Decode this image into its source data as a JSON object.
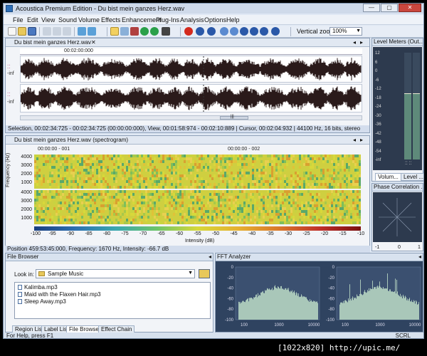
{
  "app": {
    "title": "Acoustica Premium Edition - Du bist mein ganzes Herz.wav"
  },
  "window_controls": {
    "minimize": "—",
    "maximize": "▢",
    "close": "✕"
  },
  "menu": [
    "File",
    "Edit",
    "View",
    "Sound",
    "Volume",
    "Effects",
    "Enhancement",
    "Plug-Ins",
    "Analysis",
    "Options",
    "Help"
  ],
  "toolbar": {
    "vertical_zoom_label": "Vertical zoom:",
    "vertical_zoom_value": "100%",
    "buttons": [
      "new-icon",
      "open-icon",
      "save-icon",
      "cut-icon",
      "copy-icon",
      "paste-icon",
      "undo-icon",
      "redo-icon",
      "select-tool-icon",
      "zoom-tool-icon",
      "split-icon",
      "forward-icon",
      "back-icon",
      "grid-icon",
      "record-icon",
      "rewind-icon",
      "play-icon",
      "stop-icon",
      "loop-icon",
      "fast-forward-icon",
      "end-icon"
    ]
  },
  "colors": {
    "waveform": "#2a1a1a",
    "record": "#d42a1e",
    "play": "#2aa04a",
    "transport": "#2a58a8",
    "panel_bg": "#2d3a4e"
  },
  "waveform": {
    "tab_label": "Du bist mein ganzes Herz.wav",
    "time_label": "00:02:00:000",
    "inf_label_top": "-inf",
    "inf_label_bottom": "-inf",
    "scroll_thumb": "|||",
    "status": "Selection, 00:02:34:725 - 00:02:34:725 (00:00:00:000), View, 00:01:58:974 - 00:02:10:889 | Cursor, 00:02:04:932 | 44100 Hz, 16 bits, stereo"
  },
  "spectrogram": {
    "tab_label": "Du bist mein ganzes Herz.wav (spectrogram)",
    "time_label_1": "00:00:00 - 001",
    "time_label_2": "00:00:00 - 002",
    "y_axis_label": "Frequency (Hz)",
    "y_ticks": [
      "4000",
      "3000",
      "2000",
      "1000",
      "4000",
      "3000",
      "2000",
      "1000"
    ],
    "colorbar_ticks": [
      "-100",
      "-95",
      "-90",
      "-85",
      "-80",
      "-75",
      "-70",
      "-65",
      "-60",
      "-55",
      "-50",
      "-45",
      "-40",
      "-35",
      "-30",
      "-25",
      "-20",
      "-15",
      "-10"
    ],
    "intensity_label": "Intensity (dB)",
    "status": "Position 459:53:45:000, Frequency: 1670 Hz, Intensity: -66.7 dB"
  },
  "level_meters": {
    "title": "Level Meters (Out...",
    "ticks": [
      "12",
      "6",
      "0",
      "-6",
      "-12",
      "-18",
      "-24",
      "-30",
      "-36",
      "-42",
      "-48",
      "-54",
      "-inf"
    ],
    "left_level": 0.62,
    "right_level": 0.62,
    "tabs": [
      "Volum...",
      "Level ..."
    ]
  },
  "phase_correlation": {
    "title": "Phase Correlation ...",
    "scale": [
      "-1",
      "0",
      "1"
    ]
  },
  "file_browser": {
    "title": "File Browser",
    "look_in_label": "Look in:",
    "folder": "Sample Music",
    "files": [
      "Kalimba.mp3",
      "Maid with the Flaxen Hair.mp3",
      "Sleep Away.mp3"
    ],
    "tabs": [
      "Region List",
      "Label List",
      "File Browser",
      "Effect Chain"
    ],
    "active_tab": "File Browser"
  },
  "fft": {
    "title": "FFT Analyzer",
    "y_ticks": [
      "0",
      "-20",
      "-40",
      "-60",
      "-80",
      "-100"
    ],
    "x_ticks": [
      "100",
      "1000",
      "10000"
    ]
  },
  "status_bar": {
    "help": "For Help, press F1",
    "scrl": "SCRL"
  },
  "watermark": "[1022x820] http://upic.me/"
}
